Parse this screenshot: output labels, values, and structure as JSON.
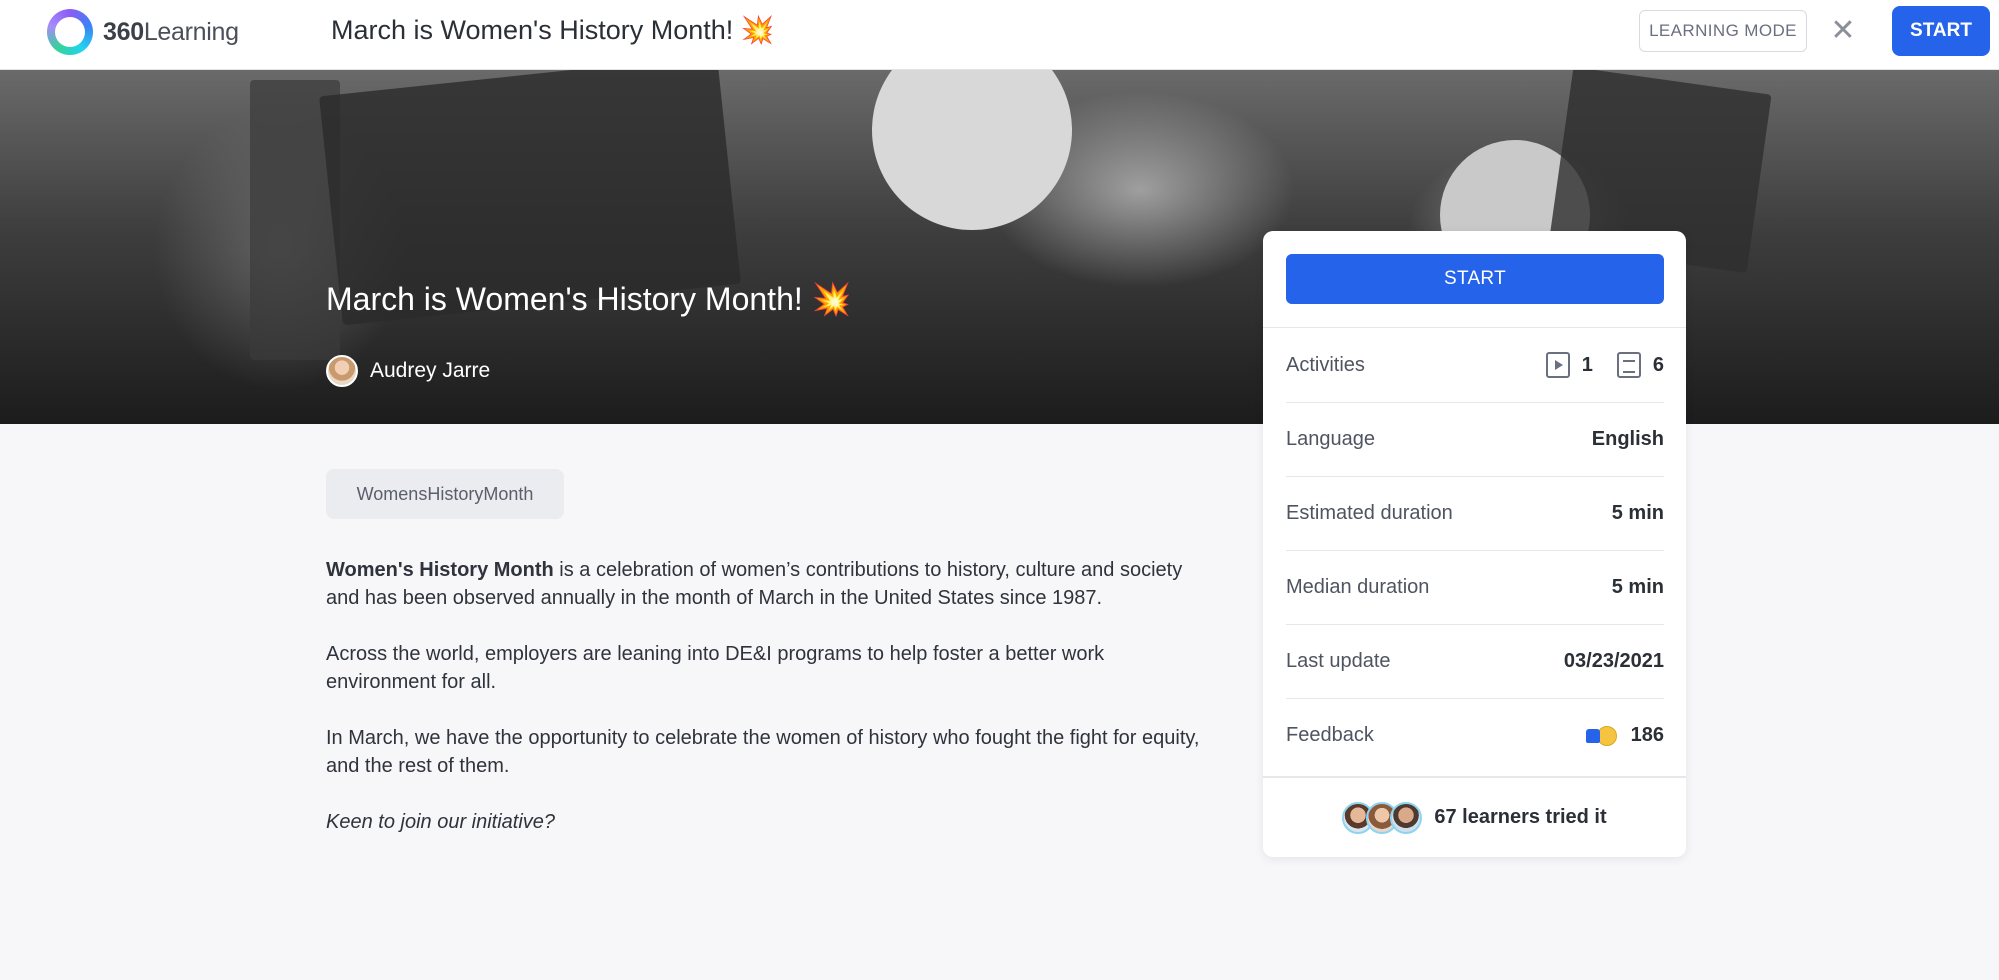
{
  "header": {
    "logo_prefix": "360",
    "logo_suffix": "Learning",
    "title": "March is Women's History Month! 💥",
    "learning_mode_label": "LEARNING MODE",
    "close_icon": "close-icon",
    "start_label": "START"
  },
  "hero": {
    "title": "March is Women's History Month! 💥",
    "author": "Audrey Jarre"
  },
  "tag": "WomensHistoryMonth",
  "description": {
    "p1_bold": "Women's History Month",
    "p1_rest": " is a celebration of women’s contributions to history, culture and society and has been observed annually in the month of March in the United States since 1987.",
    "p2": "Across the world, employers are leaning into DE&I programs to help foster a better work environment for all.",
    "p3": "In March, we have the opportunity to celebrate the women of history who fought the fight for equity, and the rest of them.",
    "p4": "Keen to join our initiative?"
  },
  "card": {
    "start_label": "START",
    "rows": {
      "activities": {
        "label": "Activities",
        "video_count": "1",
        "doc_count": "6"
      },
      "language": {
        "label": "Language",
        "value": "English"
      },
      "estimated": {
        "label": "Estimated duration",
        "value": "5 min"
      },
      "median": {
        "label": "Median duration",
        "value": "5 min"
      },
      "last_update": {
        "label": "Last update",
        "value": "03/23/2021"
      },
      "feedback": {
        "label": "Feedback",
        "value": "186"
      }
    },
    "learners": "67 learners tried it"
  },
  "colors": {
    "accent": "#2563eb",
    "background": "#f7f7fa"
  }
}
